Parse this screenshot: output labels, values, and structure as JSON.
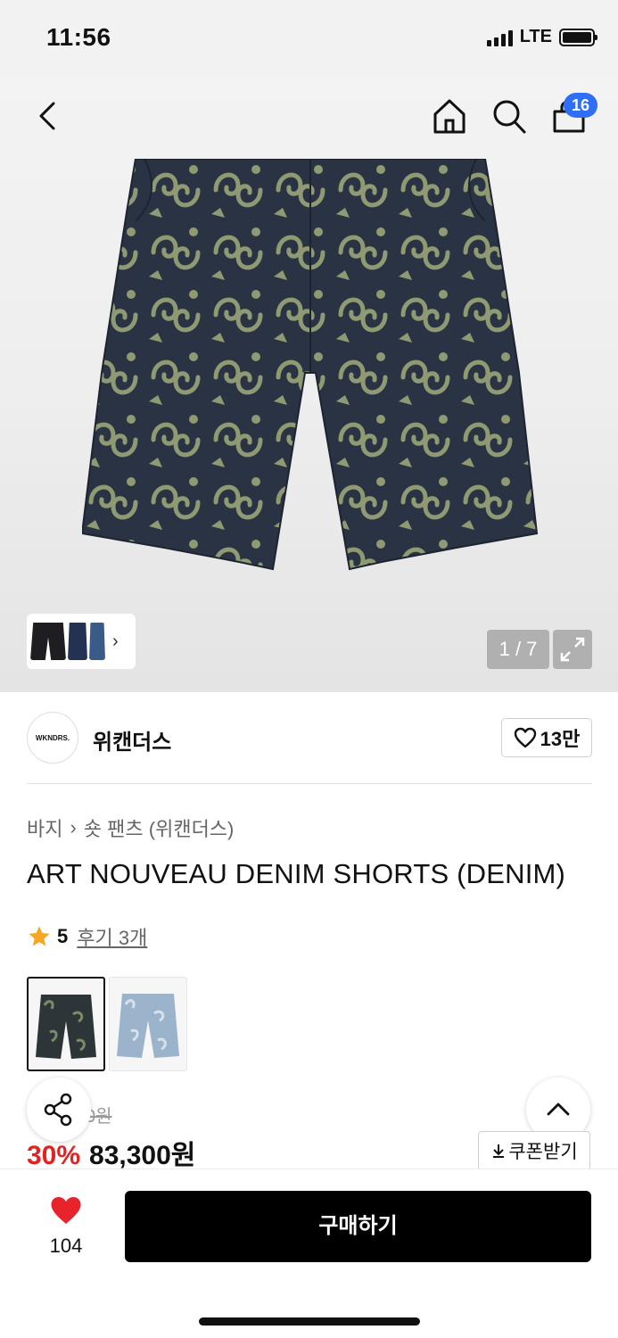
{
  "status": {
    "time": "11:56",
    "network": "LTE"
  },
  "header": {
    "cart_count": "16"
  },
  "gallery": {
    "page": "1 / 7"
  },
  "brand": {
    "logo_text": "WKNDRS.",
    "name": "위캔더스",
    "likes": "13만"
  },
  "breadcrumb": {
    "category": "바지",
    "separator": "›",
    "subcategory": "숏 팬츠 (위캔더스)"
  },
  "product": {
    "title": "ART NOUVEAU DENIM SHORTS (DENIM)",
    "rating": "5",
    "reviews": "후기 3개"
  },
  "price": {
    "original": "0원",
    "discount": "30%",
    "sale": "83,300원",
    "coupon_label": "쿠폰받기"
  },
  "bottom": {
    "wish_count": "104",
    "buy_label": "구매하기"
  },
  "colors": {
    "accent_blue": "#2f6ef6",
    "discount_red": "#e52222",
    "heart_red": "#e8232a",
    "star": "#f5a623"
  },
  "icons": [
    "back-icon",
    "home-icon",
    "search-icon",
    "cart-icon",
    "expand-icon",
    "heart-outline-icon",
    "star-icon",
    "share-icon",
    "chevron-up-icon",
    "download-icon",
    "heart-icon"
  ]
}
